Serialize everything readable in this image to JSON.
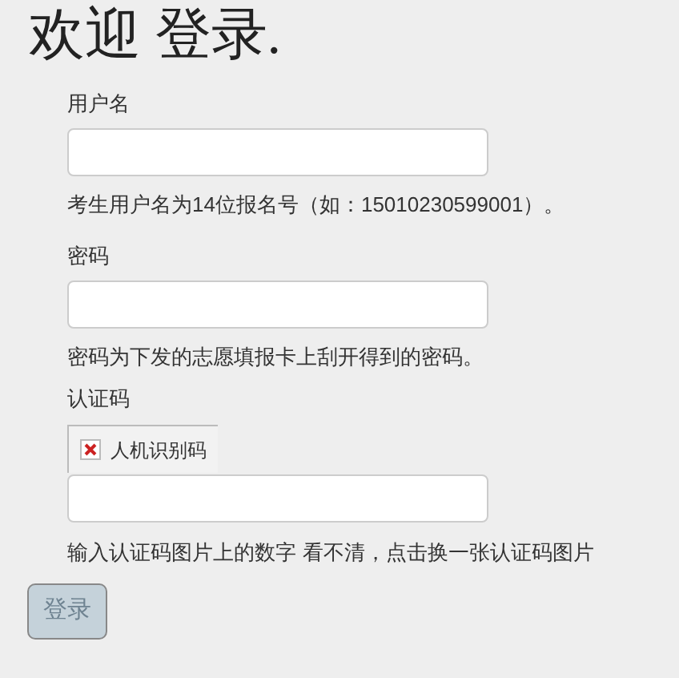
{
  "title": "欢迎 登录.",
  "fields": [
    {
      "label": "用户名",
      "hint": "考生用户名为14位报名号（如：15010230599001）。"
    },
    {
      "label": "密码",
      "hint": "密码为下发的志愿填报卡上刮开得到的密码。"
    }
  ],
  "captcha": {
    "label": "认证码",
    "image_alt": "人机识别码",
    "hint": "输入认证码图片上的数字",
    "refresh_link": "看不清，点击换一张认证码图片"
  },
  "submit": {
    "label": "登录",
    "disabled": true
  }
}
